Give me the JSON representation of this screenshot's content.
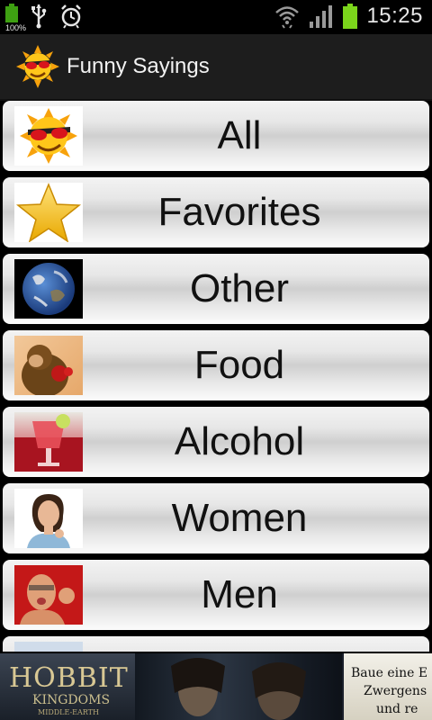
{
  "status_bar": {
    "battery_percent": "100%",
    "time": "15:25",
    "icons": [
      "battery-icon",
      "usb-icon",
      "alarm-icon",
      "wifi-icon",
      "signal-icon",
      "battery-icon"
    ]
  },
  "action_bar": {
    "title": "Funny Sayings",
    "icon": "sun-sunglasses-icon"
  },
  "categories": [
    {
      "label": "All",
      "icon": "sun-sunglasses-icon"
    },
    {
      "label": "Favorites",
      "icon": "star-icon"
    },
    {
      "label": "Other",
      "icon": "earth-icon"
    },
    {
      "label": "Food",
      "icon": "monkey-food-icon"
    },
    {
      "label": "Alcohol",
      "icon": "cocktail-icon"
    },
    {
      "label": "Women",
      "icon": "woman-icon"
    },
    {
      "label": "Men",
      "icon": "man-icon"
    }
  ],
  "ad": {
    "title": "HOBBIT",
    "subtitle": "KINGDOMS",
    "tagline": "MIDDLE-EARTH",
    "text_line1": "Baue eine E",
    "text_line2": "Zwergens",
    "text_line3": "und re"
  },
  "colors": {
    "background": "#000000",
    "action_bar": "#1d1d1d",
    "battery_green": "#7bd51b"
  }
}
